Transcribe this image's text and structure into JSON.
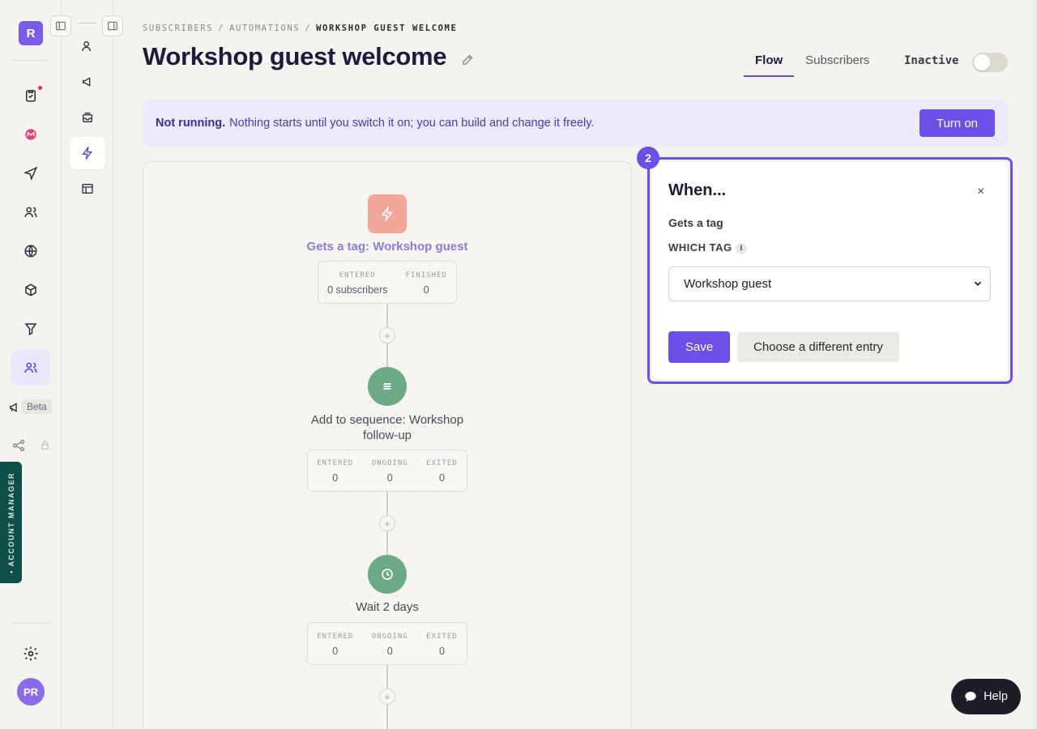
{
  "rail": {
    "logo": "R",
    "beta_label": "Beta",
    "account_manager_label": "• ACCOUNT MANAGER",
    "avatar_initials": "PR",
    "icons": [
      "checklist-icon",
      "gmail-icon",
      "send-icon",
      "users-icon",
      "globe-icon",
      "box-icon",
      "filter-icon",
      "audience-icon"
    ]
  },
  "breadcrumb": {
    "items": [
      "SUBSCRIBERS",
      "AUTOMATIONS"
    ],
    "separator": "/",
    "current": "WORKSHOP GUEST WELCOME"
  },
  "page": {
    "title": "Workshop guest welcome",
    "tabs": [
      "Flow",
      "Subscribers"
    ],
    "active_tab": "Flow",
    "status": "Inactive",
    "toggle_on": false
  },
  "banner": {
    "strong": "Not running.",
    "text": "Nothing starts until you switch it on; you can build and change it freely.",
    "button": "Turn on"
  },
  "flow": {
    "trigger": {
      "label": "Gets a tag: Workshop guest",
      "stats": [
        {
          "k": "ENTERED",
          "v": "0 subscribers"
        },
        {
          "k": "FINISHED",
          "v": "0"
        }
      ]
    },
    "sequence": {
      "label": "Add to sequence: Workshop follow-up",
      "stats": [
        {
          "k": "ENTERED",
          "v": "0"
        },
        {
          "k": "ONGOING",
          "v": "0"
        },
        {
          "k": "EXITED",
          "v": "0"
        }
      ]
    },
    "wait": {
      "label": "Wait 2 days",
      "stats": [
        {
          "k": "ENTERED",
          "v": "0"
        },
        {
          "k": "ONGOING",
          "v": "0"
        },
        {
          "k": "EXITED",
          "v": "0"
        }
      ]
    },
    "plus": "+"
  },
  "panel": {
    "step_badge": "2",
    "title": "When...",
    "close": "×",
    "subtitle": "Gets a tag",
    "field_label": "WHICH TAG",
    "info": "i",
    "selected_tag": "Workshop guest",
    "save": "Save",
    "alt": "Choose a different entry"
  },
  "help": {
    "label": "Help"
  },
  "colors": {
    "accent": "#6c4ee8",
    "trigger": "#f0a79a",
    "step": "#6ba987",
    "banner_bg": "#ece9fb"
  }
}
